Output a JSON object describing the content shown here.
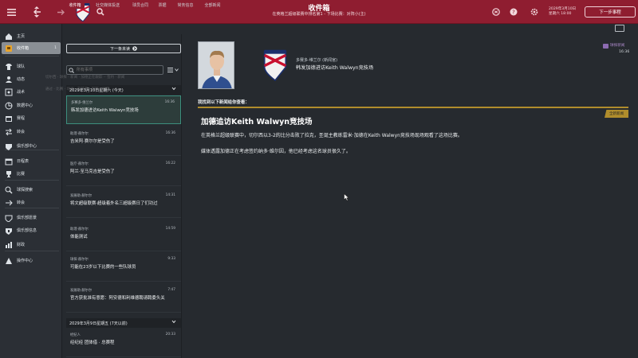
{
  "topbar": {
    "title": "收件箱",
    "subtitle1": "在英格兰超级联赛中排名第1 - 下场比赛：对阵小(主)",
    "subtitle2": "",
    "date_line1": "2029年3月10日",
    "date_line2": "星期六 18:00",
    "continue_label": "下一步事程"
  },
  "sidebar": {
    "items": [
      {
        "label": "主页"
      },
      {
        "label": "收件箱",
        "count": "1"
      },
      {
        "label": "球队"
      },
      {
        "label": "动态"
      },
      {
        "label": "战术"
      },
      {
        "label": "数据中心"
      },
      {
        "label": "赛程"
      },
      {
        "label": "转会"
      },
      {
        "label": "俱乐部中心"
      },
      {
        "label": "日程表"
      },
      {
        "label": "比赛"
      },
      {
        "label": "球探搜索"
      },
      {
        "label": "转会"
      },
      {
        "label": "俱乐部愿景"
      },
      {
        "label": "俱乐部信息"
      },
      {
        "label": "财政"
      },
      {
        "label": "操作中心"
      }
    ]
  },
  "tabs": [
    "收件箱",
    "社交媒体投送",
    "球员合同",
    "票据",
    "常务信息",
    "全部新闻"
  ],
  "list": {
    "next_unread": "下一条未读",
    "search_placeholder": "所有事项",
    "group1": "2029年3月10日星期六 (今天)",
    "group2": "2029年3月9日星期五 (7天以前)",
    "messages": [
      {
        "from": "多赛多·维兰尔",
        "time": "16:36",
        "subject": "韩发加德进访Keith Walwyn竞技场"
      },
      {
        "from": "助理·赫尔尔",
        "time": "16:36",
        "subject": "吉米阿·赛尔尔是受伤了"
      },
      {
        "from": "医疗·赫尔尔",
        "time": "16:22",
        "subject": "阿兰·至马克吉是受伤了"
      },
      {
        "from": "发展助·赫尔尔",
        "time": "14:31",
        "subject": "将文超级联赛·超级着外名三超级赛日了们功过"
      },
      {
        "from": "助理·赫尔尔",
        "time": "14:59",
        "subject": "体能测试"
      },
      {
        "from": "球探·赫尔尔",
        "time": "9:33",
        "subject": "可能在23岁以下比赛的一些队球员"
      },
      {
        "from": "发展助·赫尔尔",
        "time": "7:47",
        "subject": "官方获批准有意愿：阿安德和利维德聘请聘委头关"
      },
      {
        "from": "经纪人",
        "time": "20:33",
        "subject": "经纪经 团体借 · 总赛程"
      }
    ]
  },
  "mail": {
    "sender": "多赛多·维兰尔 (新闻官)",
    "subject": "韩发加德进访Keith Walwyn竞技场",
    "tag": "球探新闻",
    "time": "16:36",
    "found_text": "我找到以下新闻给你查看：",
    "news_badge": "全新新闻",
    "news_title": "加德追访Keith Walwyn竞技场",
    "body1": "在英格兰超级联赛中，切尔西以3-2的比分击败了拉克，圣诞主教练雷米·加德在Keith Walwyn竞技场现场观看了这场比赛。",
    "body2": "媒体透露加德正在考虑签约纳多·维尔因，他已经考虑这名球员很久了。"
  },
  "ghost": {
    "line1": "切尔西 · 球探 · 新闻 · 加德正在跟踪 ·· 签约 · 新闻",
    "line2": "通过 · 比赛 · 场地 · 在英超 · 观赛 · 加德"
  },
  "colors": {
    "brand": "#8f1d30",
    "accent_gold": "#b08d2c",
    "selection": "#3c8f7e"
  }
}
